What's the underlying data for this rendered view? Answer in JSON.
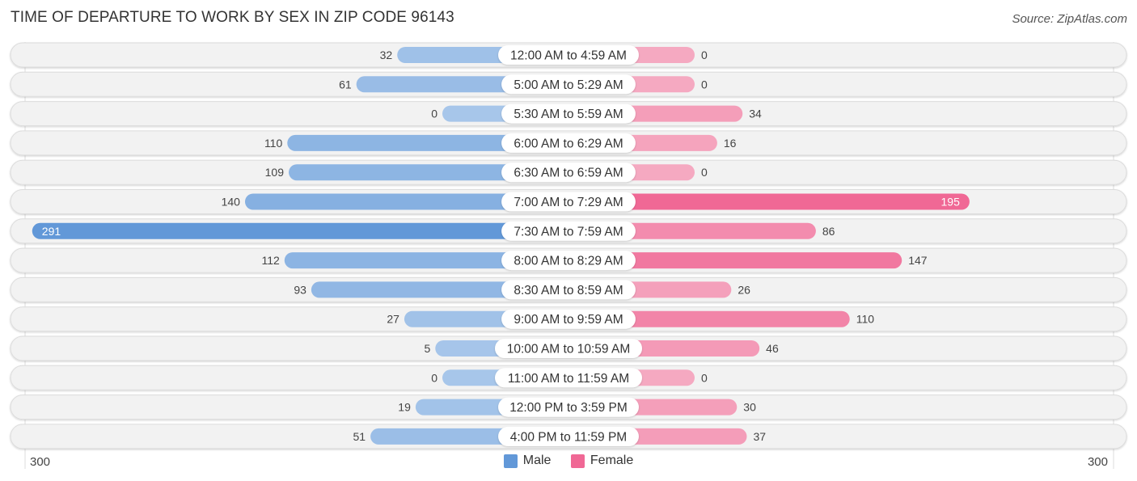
{
  "header": {
    "title": "TIME OF DEPARTURE TO WORK BY SEX IN ZIP CODE 96143",
    "source": "Source: ZipAtlas.com"
  },
  "colors": {
    "male_light": "#a7c6ea",
    "male_dark": "#6298d8",
    "female_light": "#f5a9c1",
    "female_dark": "#f06895",
    "row_bg": "#f2f2f2",
    "label_bg": "#ffffff"
  },
  "chart_data": {
    "type": "bar",
    "orientation": "horizontal-diverging",
    "title": "TIME OF DEPARTURE TO WORK BY SEX IN ZIP CODE 96143",
    "categories": [
      "12:00 AM to 4:59 AM",
      "5:00 AM to 5:29 AM",
      "5:30 AM to 5:59 AM",
      "6:00 AM to 6:29 AM",
      "6:30 AM to 6:59 AM",
      "7:00 AM to 7:29 AM",
      "7:30 AM to 7:59 AM",
      "8:00 AM to 8:29 AM",
      "8:30 AM to 8:59 AM",
      "9:00 AM to 9:59 AM",
      "10:00 AM to 10:59 AM",
      "11:00 AM to 11:59 AM",
      "12:00 PM to 3:59 PM",
      "4:00 PM to 11:59 PM"
    ],
    "series": [
      {
        "name": "Male",
        "side": "left",
        "values": [
          32,
          61,
          0,
          110,
          109,
          140,
          291,
          112,
          93,
          27,
          5,
          0,
          19,
          51
        ]
      },
      {
        "name": "Female",
        "side": "right",
        "values": [
          0,
          0,
          34,
          16,
          0,
          195,
          86,
          147,
          26,
          110,
          46,
          0,
          30,
          37
        ]
      }
    ],
    "axis": {
      "left_label": "300",
      "right_label": "300",
      "max": 300
    },
    "legend": {
      "position": "bottom-center",
      "entries": [
        "Male",
        "Female"
      ]
    },
    "grid": false
  }
}
